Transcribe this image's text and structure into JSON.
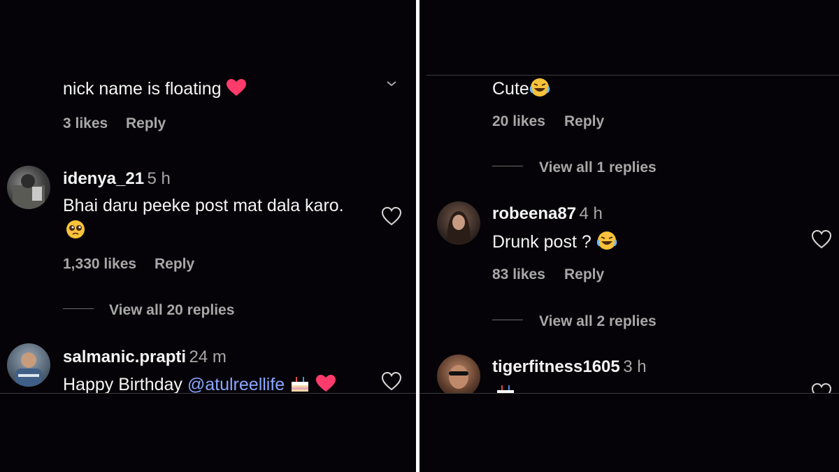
{
  "left": {
    "top_comment": {
      "text": "nick name is floating",
      "likes": "3 likes",
      "reply": "Reply"
    },
    "comments": [
      {
        "username": "idenya_21",
        "time": "5 h",
        "text": "Bhai daru peeke post mat dala karo.",
        "likes": "1,330 likes",
        "reply": "Reply",
        "view_replies": "View all 20 replies"
      },
      {
        "username": "salmanic.prapti",
        "time": "24 m",
        "text_prefix": "Happy Birthday ",
        "mention": "@atulreellife"
      }
    ]
  },
  "right": {
    "top_comment": {
      "text": "Cute",
      "likes": "20 likes",
      "reply": "Reply",
      "view_replies": "View all 1 replies"
    },
    "comments": [
      {
        "username": "robeena87",
        "time": "4 h",
        "text": "Drunk post ?",
        "likes": "83 likes",
        "reply": "Reply",
        "view_replies": "View all 2 replies"
      },
      {
        "username": "tigerfitness1605",
        "time": "3 h"
      }
    ]
  },
  "colors": {
    "background": "#050307",
    "text": "#f5f5f5",
    "muted": "#a8a8a8",
    "mention": "#8aa6ff",
    "heart_emoji": "#ff3b6b"
  },
  "icons": [
    "like-heart-icon",
    "red-heart-emoji",
    "pleading-face-emoji",
    "laughing-face-emoji",
    "birthday-cake-emoji",
    "chevron-down-icon"
  ]
}
